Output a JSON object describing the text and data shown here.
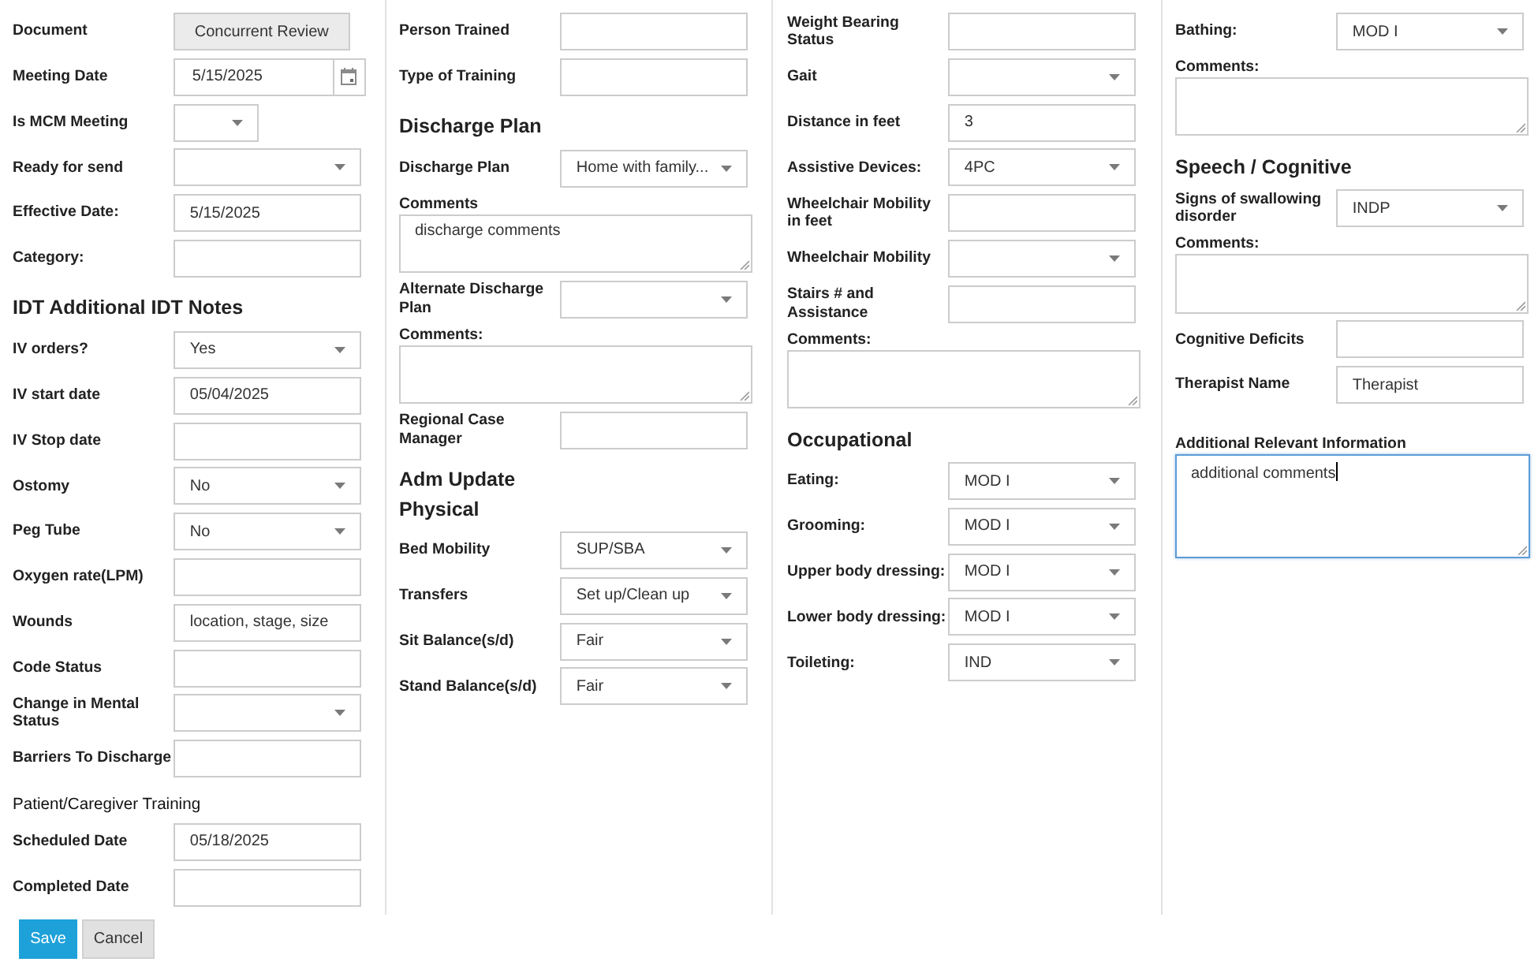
{
  "columns": [
    {
      "items": [
        {
          "kind": "button",
          "label": "Document",
          "text": "Concurrent Review"
        },
        {
          "kind": "date",
          "label": "Meeting Date",
          "value": "5/15/2025"
        },
        {
          "kind": "short-select",
          "label": "Is MCM Meeting"
        },
        {
          "kind": "select",
          "label": "Ready for send"
        },
        {
          "kind": "input",
          "label": "Effective Date:",
          "value": "5/15/2025"
        },
        {
          "kind": "input",
          "label": "Category:"
        },
        {
          "kind": "heading",
          "text": "IDT Additional IDT Notes"
        },
        {
          "kind": "select",
          "label": "IV orders?",
          "value": "Yes"
        },
        {
          "kind": "input",
          "label": "IV start date",
          "value": "05/04/2025"
        },
        {
          "kind": "input",
          "label": "IV Stop date"
        },
        {
          "kind": "select",
          "label": "Ostomy",
          "value": "No"
        },
        {
          "kind": "select",
          "label": "Peg Tube",
          "value": "No"
        },
        {
          "kind": "input",
          "label": "Oxygen rate(LPM)"
        },
        {
          "kind": "input",
          "label": "Wounds",
          "value": "location, stage, size"
        },
        {
          "kind": "input",
          "label": "Code Status"
        },
        {
          "kind": "select",
          "label": "Change in Mental Status"
        },
        {
          "kind": "input",
          "label": "Barriers To Discharge"
        },
        {
          "kind": "caption",
          "text": "Patient/Caregiver Training"
        },
        {
          "kind": "input",
          "label": "Scheduled Date",
          "value": "05/18/2025"
        },
        {
          "kind": "input",
          "label": "Completed Date"
        }
      ]
    },
    {
      "items": [
        {
          "kind": "input",
          "label": "Person Trained"
        },
        {
          "kind": "input",
          "label": "Type of Training"
        },
        {
          "kind": "heading",
          "text": "Discharge Plan"
        },
        {
          "kind": "select",
          "label": "Discharge Plan",
          "value": "Home with family..."
        },
        {
          "kind": "textarea",
          "label": "Comments",
          "value": "discharge comments",
          "focused": false
        },
        {
          "kind": "select",
          "label": "Alternate Discharge Plan"
        },
        {
          "kind": "textarea",
          "label": "Comments:",
          "focused": false
        },
        {
          "kind": "input",
          "label": "Regional Case Manager"
        },
        {
          "kind": "heading",
          "text": "Adm Update"
        },
        {
          "kind": "subheading",
          "text": "Physical"
        },
        {
          "kind": "select",
          "label": "Bed Mobility",
          "value": "SUP/SBA"
        },
        {
          "kind": "select",
          "label": "Transfers",
          "value": "Set up/Clean up"
        },
        {
          "kind": "select",
          "label": "Sit Balance(s/d)",
          "value": "Fair"
        },
        {
          "kind": "select",
          "label": "Stand Balance(s/d)",
          "value": "Fair"
        }
      ]
    },
    {
      "items": [
        {
          "kind": "input",
          "label": "Weight Bearing Status"
        },
        {
          "kind": "select",
          "label": "Gait"
        },
        {
          "kind": "input",
          "label": "Distance in feet",
          "value": "3"
        },
        {
          "kind": "select",
          "label": "Assistive Devices:",
          "value": "4PC"
        },
        {
          "kind": "input",
          "label": "Wheelchair Mobility in feet"
        },
        {
          "kind": "select",
          "label": "Wheelchair Mobility"
        },
        {
          "kind": "input",
          "label": "Stairs # and Assistance"
        },
        {
          "kind": "textarea",
          "label": "Comments:",
          "focused": false
        },
        {
          "kind": "heading",
          "text": "Occupational"
        },
        {
          "kind": "select",
          "label": "Eating:",
          "value": "MOD I"
        },
        {
          "kind": "select",
          "label": "Grooming:",
          "value": "MOD I"
        },
        {
          "kind": "select",
          "label": "Upper body dressing:",
          "value": "MOD I"
        },
        {
          "kind": "select",
          "label": "Lower body dressing:",
          "value": "MOD I"
        },
        {
          "kind": "select",
          "label": "Toileting:",
          "value": "IND"
        }
      ]
    },
    {
      "items": [
        {
          "kind": "select",
          "label": "Bathing:",
          "value": "MOD I"
        },
        {
          "kind": "textarea",
          "label": "Comments:",
          "focused": false
        },
        {
          "kind": "heading",
          "text": "Speech / Cognitive"
        },
        {
          "kind": "select",
          "label": "Signs of swallowing disorder",
          "value": "INDP"
        },
        {
          "kind": "textarea",
          "label": "Comments:",
          "focused": false
        },
        {
          "kind": "input",
          "label": "Cognitive Deficits"
        },
        {
          "kind": "input",
          "label": "Therapist Name",
          "value": "Therapist"
        },
        {
          "kind": "notes",
          "label": "Additional Relevant Information",
          "value": "additional comments",
          "focused": true
        }
      ]
    }
  ],
  "buttons": [
    {
      "kind": "primary",
      "label": "Save"
    },
    {
      "kind": "secondary",
      "label": "Cancel"
    }
  ]
}
